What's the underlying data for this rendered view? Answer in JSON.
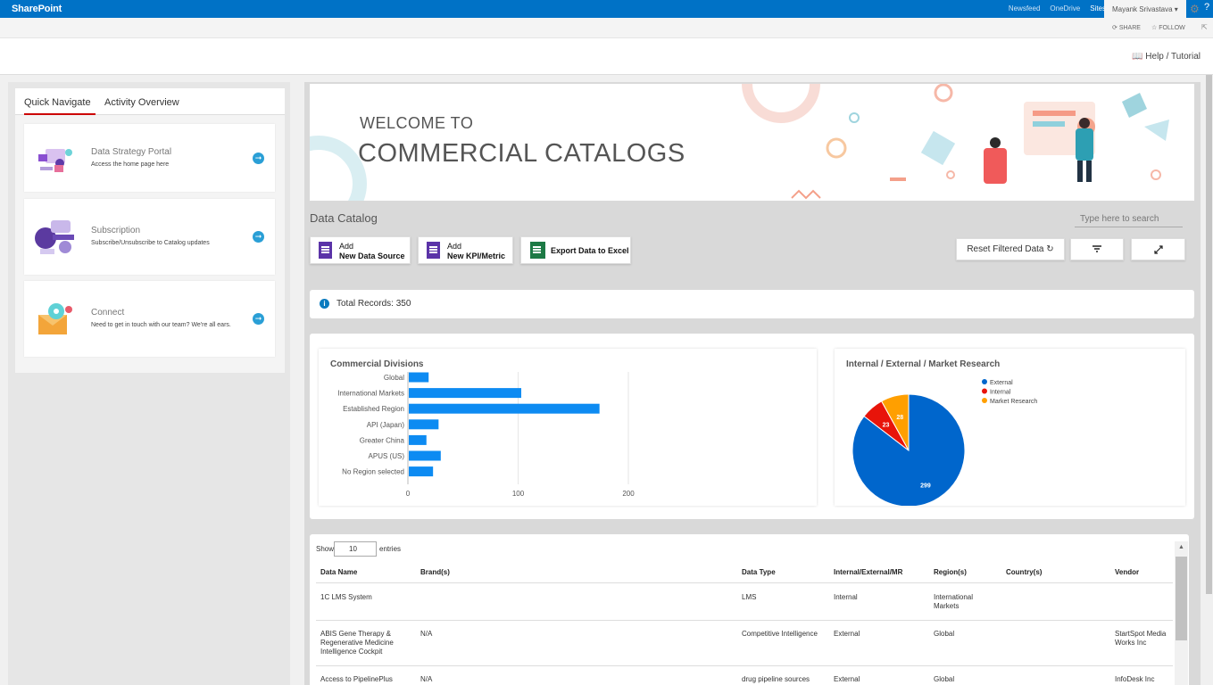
{
  "suite": {
    "brand": "SharePoint",
    "links": [
      "Newsfeed",
      "OneDrive",
      "Sites"
    ],
    "user": "Mayank Srivastava ▾",
    "share": "SHARE",
    "follow": "FOLLOW"
  },
  "header": {
    "help": "Help / Tutorial"
  },
  "left": {
    "tabs": [
      "Quick Navigate",
      "Activity Overview"
    ],
    "cards": [
      {
        "title": "Data Strategy Portal",
        "sub": "Access the home page here"
      },
      {
        "title": "Subscription",
        "sub": "Subscribe/Unsubscribe to Catalog updates"
      },
      {
        "title": "Connect",
        "sub": "Need to get in touch with our team? We're all ears."
      }
    ]
  },
  "banner": {
    "line1": "WELCOME TO",
    "line2": "COMMERCIAL CATALOGS"
  },
  "catalog": {
    "title": "Data Catalog",
    "search_placeholder": "Type here to search",
    "btn_add": "Add",
    "btn_source": "New Data Source",
    "btn_kpi": "New KPI/Metric",
    "btn_export": "Export Data to Excel",
    "btn_reset": "Reset Filtered Data",
    "total": "Total Records: 350"
  },
  "colors": {
    "suitebar": "#0072c6",
    "bar": "#0d8bf2",
    "external": "#0066cc",
    "internal": "#e8140a",
    "market": "#ff9f00"
  },
  "chart_data": [
    {
      "type": "bar",
      "title": "Commercial Divisions",
      "orientation": "horizontal",
      "categories": [
        "Global",
        "International Markets",
        "Established Region",
        "API (Japan)",
        "Greater China",
        "APUS (US)",
        "No Region selected"
      ],
      "values": [
        18,
        102,
        173,
        27,
        16,
        29,
        22
      ],
      "xlim": [
        0,
        200
      ],
      "xticks": [
        0,
        100,
        200
      ]
    },
    {
      "type": "pie",
      "title": "Internal / External / Market Research",
      "labels": [
        "External",
        "Internal",
        "Market Research"
      ],
      "values": [
        299,
        23,
        28
      ],
      "legend": "top-right"
    }
  ],
  "table": {
    "show": "Show",
    "entries_value": "10",
    "entries": "entries",
    "columns": [
      "Data Name",
      "Brand(s)",
      "Data Type",
      "Internal/External/MR",
      "Region(s)",
      "Country(s)",
      "Vendor"
    ],
    "rows": [
      [
        "1C LMS System",
        "",
        "LMS",
        "Internal",
        "International Markets",
        "",
        ""
      ],
      [
        "ABIS Gene Therapy & Regenerative Medicine Intelligence Cockpit",
        "N/A",
        "Competitive Intelligence",
        "External",
        "Global",
        "",
        "StartSpot Media Works Inc"
      ],
      [
        "Access to PipelinePlus",
        "N/A",
        "drug pipeline sources",
        "External",
        "Global",
        "",
        "InfoDesk Inc"
      ]
    ]
  }
}
